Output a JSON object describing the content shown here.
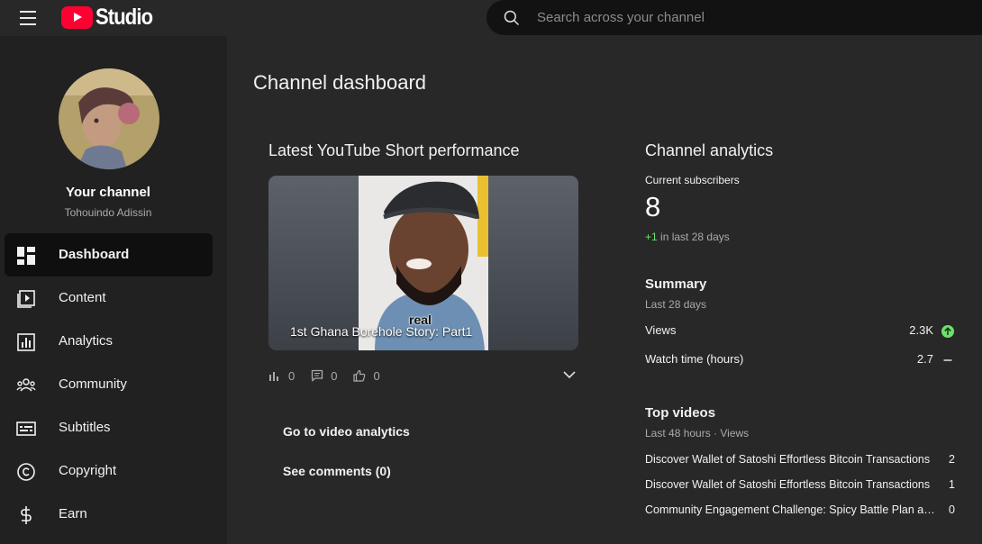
{
  "header": {
    "logo_text": "Studio",
    "search_placeholder": "Search across your channel"
  },
  "sidebar": {
    "channel_label": "Your channel",
    "channel_name": "Tohouindo Adissin",
    "items": [
      {
        "label": "Dashboard",
        "icon": "dashboard-icon",
        "active": true
      },
      {
        "label": "Content",
        "icon": "content-icon"
      },
      {
        "label": "Analytics",
        "icon": "analytics-icon"
      },
      {
        "label": "Community",
        "icon": "community-icon"
      },
      {
        "label": "Subtitles",
        "icon": "subtitles-icon"
      },
      {
        "label": "Copyright",
        "icon": "copyright-icon"
      },
      {
        "label": "Earn",
        "icon": "earn-icon"
      }
    ]
  },
  "main": {
    "title": "Channel dashboard",
    "latest_short": {
      "heading": "Latest YouTube Short performance",
      "video_title": "1st Ghana Borehole Story: Part1",
      "caption_word": "real",
      "views": "0",
      "comments": "0",
      "likes": "0",
      "actions": [
        "Go to video analytics",
        "See comments (0)"
      ]
    },
    "analytics": {
      "heading": "Channel analytics",
      "subs_label": "Current subscribers",
      "subs_count": "8",
      "subs_change": "+1",
      "subs_change_period": "in last 28 days",
      "summary_heading": "Summary",
      "summary_period": "Last 28 days",
      "summary_rows": [
        {
          "label": "Views",
          "value": "2.3K",
          "trend": "up"
        },
        {
          "label": "Watch time (hours)",
          "value": "2.7",
          "trend": "flat"
        }
      ],
      "top_heading": "Top videos",
      "top_period": "Last 48 hours · Views",
      "top_videos": [
        {
          "title": "Discover Wallet of Satoshi Effortless Bitcoin Transactions",
          "views": "2"
        },
        {
          "title": "Discover Wallet of Satoshi Effortless Bitcoin Transactions",
          "views": "1"
        },
        {
          "title": "Community Engagement Challenge: Spicy Battle Plan and More",
          "views": "0"
        }
      ]
    }
  },
  "colors": {
    "background": "#282828",
    "sidebar": "#212121",
    "accent_red": "#ff0033",
    "positive_green": "#6ee06e"
  }
}
